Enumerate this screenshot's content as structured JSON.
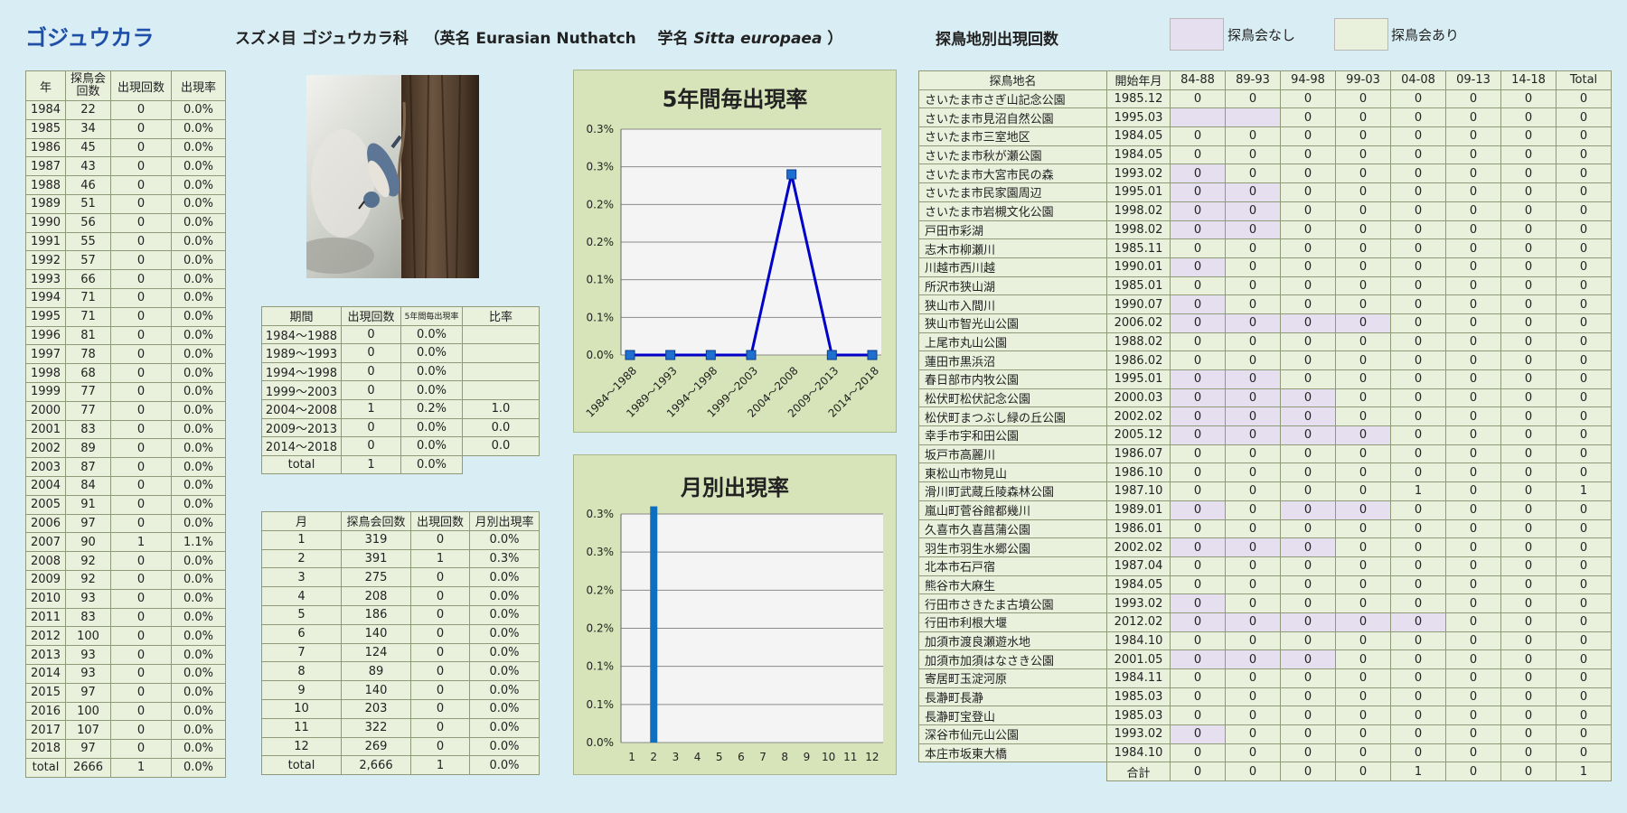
{
  "header": {
    "title": "ゴジュウカラ",
    "order_family": "スズメ目 ゴジュウカラ科",
    "english_prefix": "（英名 Eurasian Nuthatch",
    "sci_prefix": "学名",
    "sci_name": "Sitta europaea",
    "sci_suffix": "）",
    "location_title": "探鳥地別出現回数",
    "legend_nomeet": "探鳥会なし",
    "legend_meet": "探鳥会あり"
  },
  "colors": {
    "nomeet": "#e5dff0",
    "meet": "#e9f0dc",
    "line": "#0000c8",
    "bar": "#0f6fbf",
    "chart_bg": "#d7e3b8"
  },
  "year_table": {
    "headers": [
      "年",
      "探鳥会回数",
      "出現回数",
      "出現率"
    ],
    "rows": [
      [
        "1984",
        "22",
        "0",
        "0.0%"
      ],
      [
        "1985",
        "34",
        "0",
        "0.0%"
      ],
      [
        "1986",
        "45",
        "0",
        "0.0%"
      ],
      [
        "1987",
        "43",
        "0",
        "0.0%"
      ],
      [
        "1988",
        "46",
        "0",
        "0.0%"
      ],
      [
        "1989",
        "51",
        "0",
        "0.0%"
      ],
      [
        "1990",
        "56",
        "0",
        "0.0%"
      ],
      [
        "1991",
        "55",
        "0",
        "0.0%"
      ],
      [
        "1992",
        "57",
        "0",
        "0.0%"
      ],
      [
        "1993",
        "66",
        "0",
        "0.0%"
      ],
      [
        "1994",
        "71",
        "0",
        "0.0%"
      ],
      [
        "1995",
        "71",
        "0",
        "0.0%"
      ],
      [
        "1996",
        "81",
        "0",
        "0.0%"
      ],
      [
        "1997",
        "78",
        "0",
        "0.0%"
      ],
      [
        "1998",
        "68",
        "0",
        "0.0%"
      ],
      [
        "1999",
        "77",
        "0",
        "0.0%"
      ],
      [
        "2000",
        "77",
        "0",
        "0.0%"
      ],
      [
        "2001",
        "83",
        "0",
        "0.0%"
      ],
      [
        "2002",
        "89",
        "0",
        "0.0%"
      ],
      [
        "2003",
        "87",
        "0",
        "0.0%"
      ],
      [
        "2004",
        "84",
        "0",
        "0.0%"
      ],
      [
        "2005",
        "91",
        "0",
        "0.0%"
      ],
      [
        "2006",
        "97",
        "0",
        "0.0%"
      ],
      [
        "2007",
        "90",
        "1",
        "1.1%"
      ],
      [
        "2008",
        "92",
        "0",
        "0.0%"
      ],
      [
        "2009",
        "92",
        "0",
        "0.0%"
      ],
      [
        "2010",
        "93",
        "0",
        "0.0%"
      ],
      [
        "2011",
        "83",
        "0",
        "0.0%"
      ],
      [
        "2012",
        "100",
        "0",
        "0.0%"
      ],
      [
        "2013",
        "93",
        "0",
        "0.0%"
      ],
      [
        "2014",
        "93",
        "0",
        "0.0%"
      ],
      [
        "2015",
        "97",
        "0",
        "0.0%"
      ],
      [
        "2016",
        "100",
        "0",
        "0.0%"
      ],
      [
        "2017",
        "107",
        "0",
        "0.0%"
      ],
      [
        "2018",
        "97",
        "0",
        "0.0%"
      ],
      [
        "total",
        "2666",
        "1",
        "0.0%"
      ]
    ]
  },
  "period_table": {
    "headers": [
      "期間",
      "出現回数",
      "5年間毎出現率",
      "比率"
    ],
    "rows": [
      [
        "1984～1988",
        "0",
        "0.0%",
        ""
      ],
      [
        "1989～1993",
        "0",
        "0.0%",
        ""
      ],
      [
        "1994～1998",
        "0",
        "0.0%",
        ""
      ],
      [
        "1999～2003",
        "0",
        "0.0%",
        ""
      ],
      [
        "2004～2008",
        "1",
        "0.2%",
        "1.0"
      ],
      [
        "2009～2013",
        "0",
        "0.0%",
        "0.0"
      ],
      [
        "2014～2018",
        "0",
        "0.0%",
        "0.0"
      ]
    ],
    "total": [
      "total",
      "1",
      "0.0%"
    ]
  },
  "month_table": {
    "headers": [
      "月",
      "探鳥会回数",
      "出現回数",
      "月別出現率"
    ],
    "rows": [
      [
        "1",
        "319",
        "0",
        "0.0%"
      ],
      [
        "2",
        "391",
        "1",
        "0.3%"
      ],
      [
        "3",
        "275",
        "0",
        "0.0%"
      ],
      [
        "4",
        "208",
        "0",
        "0.0%"
      ],
      [
        "5",
        "186",
        "0",
        "0.0%"
      ],
      [
        "6",
        "140",
        "0",
        "0.0%"
      ],
      [
        "7",
        "124",
        "0",
        "0.0%"
      ],
      [
        "8",
        "89",
        "0",
        "0.0%"
      ],
      [
        "9",
        "140",
        "0",
        "0.0%"
      ],
      [
        "10",
        "203",
        "0",
        "0.0%"
      ],
      [
        "11",
        "322",
        "0",
        "0.0%"
      ],
      [
        "12",
        "269",
        "0",
        "0.0%"
      ],
      [
        "total",
        "2,666",
        "1",
        "0.0%"
      ]
    ]
  },
  "loc_table": {
    "headers": [
      "探鳥地名",
      "開始年月",
      "84-88",
      "89-93",
      "94-98",
      "99-03",
      "04-08",
      "09-13",
      "14-18",
      "Total"
    ],
    "rows": [
      {
        "name": "さいたま市さぎ山記念公園",
        "start": "1985.12",
        "vals": [
          "0",
          "0",
          "0",
          "0",
          "0",
          "0",
          "0",
          "0"
        ],
        "nomeet": []
      },
      {
        "name": "さいたま市見沼自然公園",
        "start": "1995.03",
        "vals": [
          "",
          "",
          "0",
          "0",
          "0",
          "0",
          "0",
          "0"
        ],
        "nomeet": [
          0,
          1
        ]
      },
      {
        "name": "さいたま市三室地区",
        "start": "1984.05",
        "vals": [
          "0",
          "0",
          "0",
          "0",
          "0",
          "0",
          "0",
          "0"
        ],
        "nomeet": []
      },
      {
        "name": "さいたま市秋が瀬公園",
        "start": "1984.05",
        "vals": [
          "0",
          "0",
          "0",
          "0",
          "0",
          "0",
          "0",
          "0"
        ],
        "nomeet": []
      },
      {
        "name": "さいたま市大宮市民の森",
        "start": "1993.02",
        "vals": [
          "0",
          "0",
          "0",
          "0",
          "0",
          "0",
          "0",
          "0"
        ],
        "nomeet": [
          0
        ]
      },
      {
        "name": "さいたま市民家園周辺",
        "start": "1995.01",
        "vals": [
          "0",
          "0",
          "0",
          "0",
          "0",
          "0",
          "0",
          "0"
        ],
        "nomeet": [
          0,
          1
        ]
      },
      {
        "name": "さいたま市岩槻文化公園",
        "start": "1998.02",
        "vals": [
          "0",
          "0",
          "0",
          "0",
          "0",
          "0",
          "0",
          "0"
        ],
        "nomeet": [
          0,
          1
        ]
      },
      {
        "name": "戸田市彩湖",
        "start": "1998.02",
        "vals": [
          "0",
          "0",
          "0",
          "0",
          "0",
          "0",
          "0",
          "0"
        ],
        "nomeet": [
          0,
          1
        ]
      },
      {
        "name": "志木市柳瀬川",
        "start": "1985.11",
        "vals": [
          "0",
          "0",
          "0",
          "0",
          "0",
          "0",
          "0",
          "0"
        ],
        "nomeet": []
      },
      {
        "name": "川越市西川越",
        "start": "1990.01",
        "vals": [
          "0",
          "0",
          "0",
          "0",
          "0",
          "0",
          "0",
          "0"
        ],
        "nomeet": [
          0
        ]
      },
      {
        "name": "所沢市狭山湖",
        "start": "1985.01",
        "vals": [
          "0",
          "0",
          "0",
          "0",
          "0",
          "0",
          "0",
          "0"
        ],
        "nomeet": []
      },
      {
        "name": "狭山市入間川",
        "start": "1990.07",
        "vals": [
          "0",
          "0",
          "0",
          "0",
          "0",
          "0",
          "0",
          "0"
        ],
        "nomeet": [
          0
        ]
      },
      {
        "name": "狭山市智光山公園",
        "start": "2006.02",
        "vals": [
          "0",
          "0",
          "0",
          "0",
          "0",
          "0",
          "0",
          "0"
        ],
        "nomeet": [
          0,
          1,
          2,
          3
        ]
      },
      {
        "name": "上尾市丸山公園",
        "start": "1988.02",
        "vals": [
          "0",
          "0",
          "0",
          "0",
          "0",
          "0",
          "0",
          "0"
        ],
        "nomeet": []
      },
      {
        "name": "蓮田市黒浜沼",
        "start": "1986.02",
        "vals": [
          "0",
          "0",
          "0",
          "0",
          "0",
          "0",
          "0",
          "0"
        ],
        "nomeet": []
      },
      {
        "name": "春日部市内牧公園",
        "start": "1995.01",
        "vals": [
          "0",
          "0",
          "0",
          "0",
          "0",
          "0",
          "0",
          "0"
        ],
        "nomeet": [
          0,
          1
        ]
      },
      {
        "name": "松伏町松伏記念公園",
        "start": "2000.03",
        "vals": [
          "0",
          "0",
          "0",
          "0",
          "0",
          "0",
          "0",
          "0"
        ],
        "nomeet": [
          0,
          1,
          2
        ]
      },
      {
        "name": "松伏町まつぶし緑の丘公園",
        "start": "2002.02",
        "vals": [
          "0",
          "0",
          "0",
          "0",
          "0",
          "0",
          "0",
          "0"
        ],
        "nomeet": [
          0,
          1,
          2
        ]
      },
      {
        "name": "幸手市宇和田公園",
        "start": "2005.12",
        "vals": [
          "0",
          "0",
          "0",
          "0",
          "0",
          "0",
          "0",
          "0"
        ],
        "nomeet": [
          0,
          1,
          2,
          3
        ]
      },
      {
        "name": "坂戸市高麗川",
        "start": "1986.07",
        "vals": [
          "0",
          "0",
          "0",
          "0",
          "0",
          "0",
          "0",
          "0"
        ],
        "nomeet": []
      },
      {
        "name": "東松山市物見山",
        "start": "1986.10",
        "vals": [
          "0",
          "0",
          "0",
          "0",
          "0",
          "0",
          "0",
          "0"
        ],
        "nomeet": []
      },
      {
        "name": "滑川町武蔵丘陵森林公園",
        "start": "1987.10",
        "vals": [
          "0",
          "0",
          "0",
          "0",
          "1",
          "0",
          "0",
          "1"
        ],
        "nomeet": []
      },
      {
        "name": "嵐山町菅谷館都幾川",
        "start": "1989.01",
        "vals": [
          "0",
          "0",
          "0",
          "0",
          "0",
          "0",
          "0",
          "0"
        ],
        "nomeet": [
          0,
          2,
          3
        ]
      },
      {
        "name": "久喜市久喜菖蒲公園",
        "start": "1986.01",
        "vals": [
          "0",
          "0",
          "0",
          "0",
          "0",
          "0",
          "0",
          "0"
        ],
        "nomeet": []
      },
      {
        "name": "羽生市羽生水郷公園",
        "start": "2002.02",
        "vals": [
          "0",
          "0",
          "0",
          "0",
          "0",
          "0",
          "0",
          "0"
        ],
        "nomeet": [
          0,
          1,
          2
        ]
      },
      {
        "name": "北本市石戸宿",
        "start": "1987.04",
        "vals": [
          "0",
          "0",
          "0",
          "0",
          "0",
          "0",
          "0",
          "0"
        ],
        "nomeet": []
      },
      {
        "name": "熊谷市大麻生",
        "start": "1984.05",
        "vals": [
          "0",
          "0",
          "0",
          "0",
          "0",
          "0",
          "0",
          "0"
        ],
        "nomeet": []
      },
      {
        "name": "行田市さきたま古墳公園",
        "start": "1993.02",
        "vals": [
          "0",
          "0",
          "0",
          "0",
          "0",
          "0",
          "0",
          "0"
        ],
        "nomeet": [
          0
        ]
      },
      {
        "name": "行田市利根大堰",
        "start": "2012.02",
        "vals": [
          "0",
          "0",
          "0",
          "0",
          "0",
          "0",
          "0",
          "0"
        ],
        "nomeet": [
          0,
          1,
          2,
          3,
          4
        ]
      },
      {
        "name": "加須市渡良瀬遊水地",
        "start": "1984.10",
        "vals": [
          "0",
          "0",
          "0",
          "0",
          "0",
          "0",
          "0",
          "0"
        ],
        "nomeet": []
      },
      {
        "name": "加須市加須はなさき公園",
        "start": "2001.05",
        "vals": [
          "0",
          "0",
          "0",
          "0",
          "0",
          "0",
          "0",
          "0"
        ],
        "nomeet": [
          0,
          1,
          2
        ]
      },
      {
        "name": "寄居町玉淀河原",
        "start": "1984.11",
        "vals": [
          "0",
          "0",
          "0",
          "0",
          "0",
          "0",
          "0",
          "0"
        ],
        "nomeet": []
      },
      {
        "name": "長瀞町長瀞",
        "start": "1985.03",
        "vals": [
          "0",
          "0",
          "0",
          "0",
          "0",
          "0",
          "0",
          "0"
        ],
        "nomeet": []
      },
      {
        "name": "長瀞町宝登山",
        "start": "1985.03",
        "vals": [
          "0",
          "0",
          "0",
          "0",
          "0",
          "0",
          "0",
          "0"
        ],
        "nomeet": []
      },
      {
        "name": "深谷市仙元山公園",
        "start": "1993.02",
        "vals": [
          "0",
          "0",
          "0",
          "0",
          "0",
          "0",
          "0",
          "0"
        ],
        "nomeet": [
          0
        ]
      },
      {
        "name": "本庄市坂東大橋",
        "start": "1984.10",
        "vals": [
          "0",
          "0",
          "0",
          "0",
          "0",
          "0",
          "0",
          "0"
        ],
        "nomeet": []
      }
    ],
    "total_label": "合計",
    "totals": [
      "0",
      "0",
      "0",
      "0",
      "1",
      "0",
      "0",
      "1"
    ]
  },
  "chart_data": [
    {
      "type": "line",
      "title": "5年間毎出現率",
      "categories": [
        "1984～1988",
        "1989～1993",
        "1994～1998",
        "1999～2003",
        "2004～2008",
        "2009～2013",
        "2014～2018"
      ],
      "values": [
        0.0,
        0.0,
        0.0,
        0.0,
        0.24,
        0.0,
        0.0
      ],
      "ylim": [
        0,
        0.3
      ],
      "yticks": [
        "0.0%",
        "0.1%",
        "0.1%",
        "0.2%",
        "0.2%",
        "0.3%"
      ],
      "ytick_values": [
        0,
        0.05,
        0.1,
        0.15,
        0.2,
        0.25,
        0.3
      ],
      "ytick_labels": [
        "0.0%",
        "0.1%",
        "0.1%",
        "0.2%",
        "0.2%",
        "0.3%",
        "0.3%"
      ],
      "grid": true
    },
    {
      "type": "bar",
      "title": "月別出現率",
      "categories": [
        "1",
        "2",
        "3",
        "4",
        "5",
        "6",
        "7",
        "8",
        "9",
        "10",
        "11",
        "12"
      ],
      "values": [
        0,
        0.31,
        0,
        0,
        0,
        0,
        0,
        0,
        0,
        0,
        0,
        0
      ],
      "ylim": [
        0,
        0.3
      ],
      "ytick_values": [
        0,
        0.05,
        0.1,
        0.15,
        0.2,
        0.25,
        0.3
      ],
      "ytick_labels": [
        "0.0%",
        "0.1%",
        "0.1%",
        "0.2%",
        "0.2%",
        "0.3%",
        "0.3%"
      ],
      "grid": true
    }
  ]
}
